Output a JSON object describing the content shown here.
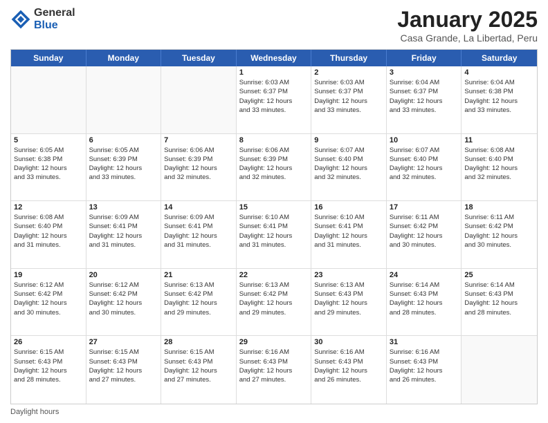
{
  "logo": {
    "general": "General",
    "blue": "Blue"
  },
  "title": {
    "month": "January 2025",
    "location": "Casa Grande, La Libertad, Peru"
  },
  "header_days": [
    "Sunday",
    "Monday",
    "Tuesday",
    "Wednesday",
    "Thursday",
    "Friday",
    "Saturday"
  ],
  "weeks": [
    [
      {
        "day": "",
        "info": ""
      },
      {
        "day": "",
        "info": ""
      },
      {
        "day": "",
        "info": ""
      },
      {
        "day": "1",
        "info": "Sunrise: 6:03 AM\nSunset: 6:37 PM\nDaylight: 12 hours\nand 33 minutes."
      },
      {
        "day": "2",
        "info": "Sunrise: 6:03 AM\nSunset: 6:37 PM\nDaylight: 12 hours\nand 33 minutes."
      },
      {
        "day": "3",
        "info": "Sunrise: 6:04 AM\nSunset: 6:37 PM\nDaylight: 12 hours\nand 33 minutes."
      },
      {
        "day": "4",
        "info": "Sunrise: 6:04 AM\nSunset: 6:38 PM\nDaylight: 12 hours\nand 33 minutes."
      }
    ],
    [
      {
        "day": "5",
        "info": "Sunrise: 6:05 AM\nSunset: 6:38 PM\nDaylight: 12 hours\nand 33 minutes."
      },
      {
        "day": "6",
        "info": "Sunrise: 6:05 AM\nSunset: 6:39 PM\nDaylight: 12 hours\nand 33 minutes."
      },
      {
        "day": "7",
        "info": "Sunrise: 6:06 AM\nSunset: 6:39 PM\nDaylight: 12 hours\nand 32 minutes."
      },
      {
        "day": "8",
        "info": "Sunrise: 6:06 AM\nSunset: 6:39 PM\nDaylight: 12 hours\nand 32 minutes."
      },
      {
        "day": "9",
        "info": "Sunrise: 6:07 AM\nSunset: 6:40 PM\nDaylight: 12 hours\nand 32 minutes."
      },
      {
        "day": "10",
        "info": "Sunrise: 6:07 AM\nSunset: 6:40 PM\nDaylight: 12 hours\nand 32 minutes."
      },
      {
        "day": "11",
        "info": "Sunrise: 6:08 AM\nSunset: 6:40 PM\nDaylight: 12 hours\nand 32 minutes."
      }
    ],
    [
      {
        "day": "12",
        "info": "Sunrise: 6:08 AM\nSunset: 6:40 PM\nDaylight: 12 hours\nand 31 minutes."
      },
      {
        "day": "13",
        "info": "Sunrise: 6:09 AM\nSunset: 6:41 PM\nDaylight: 12 hours\nand 31 minutes."
      },
      {
        "day": "14",
        "info": "Sunrise: 6:09 AM\nSunset: 6:41 PM\nDaylight: 12 hours\nand 31 minutes."
      },
      {
        "day": "15",
        "info": "Sunrise: 6:10 AM\nSunset: 6:41 PM\nDaylight: 12 hours\nand 31 minutes."
      },
      {
        "day": "16",
        "info": "Sunrise: 6:10 AM\nSunset: 6:41 PM\nDaylight: 12 hours\nand 31 minutes."
      },
      {
        "day": "17",
        "info": "Sunrise: 6:11 AM\nSunset: 6:42 PM\nDaylight: 12 hours\nand 30 minutes."
      },
      {
        "day": "18",
        "info": "Sunrise: 6:11 AM\nSunset: 6:42 PM\nDaylight: 12 hours\nand 30 minutes."
      }
    ],
    [
      {
        "day": "19",
        "info": "Sunrise: 6:12 AM\nSunset: 6:42 PM\nDaylight: 12 hours\nand 30 minutes."
      },
      {
        "day": "20",
        "info": "Sunrise: 6:12 AM\nSunset: 6:42 PM\nDaylight: 12 hours\nand 30 minutes."
      },
      {
        "day": "21",
        "info": "Sunrise: 6:13 AM\nSunset: 6:42 PM\nDaylight: 12 hours\nand 29 minutes."
      },
      {
        "day": "22",
        "info": "Sunrise: 6:13 AM\nSunset: 6:42 PM\nDaylight: 12 hours\nand 29 minutes."
      },
      {
        "day": "23",
        "info": "Sunrise: 6:13 AM\nSunset: 6:43 PM\nDaylight: 12 hours\nand 29 minutes."
      },
      {
        "day": "24",
        "info": "Sunrise: 6:14 AM\nSunset: 6:43 PM\nDaylight: 12 hours\nand 28 minutes."
      },
      {
        "day": "25",
        "info": "Sunrise: 6:14 AM\nSunset: 6:43 PM\nDaylight: 12 hours\nand 28 minutes."
      }
    ],
    [
      {
        "day": "26",
        "info": "Sunrise: 6:15 AM\nSunset: 6:43 PM\nDaylight: 12 hours\nand 28 minutes."
      },
      {
        "day": "27",
        "info": "Sunrise: 6:15 AM\nSunset: 6:43 PM\nDaylight: 12 hours\nand 27 minutes."
      },
      {
        "day": "28",
        "info": "Sunrise: 6:15 AM\nSunset: 6:43 PM\nDaylight: 12 hours\nand 27 minutes."
      },
      {
        "day": "29",
        "info": "Sunrise: 6:16 AM\nSunset: 6:43 PM\nDaylight: 12 hours\nand 27 minutes."
      },
      {
        "day": "30",
        "info": "Sunrise: 6:16 AM\nSunset: 6:43 PM\nDaylight: 12 hours\nand 26 minutes."
      },
      {
        "day": "31",
        "info": "Sunrise: 6:16 AM\nSunset: 6:43 PM\nDaylight: 12 hours\nand 26 minutes."
      },
      {
        "day": "",
        "info": ""
      }
    ]
  ],
  "footer": {
    "daylight_label": "Daylight hours"
  }
}
